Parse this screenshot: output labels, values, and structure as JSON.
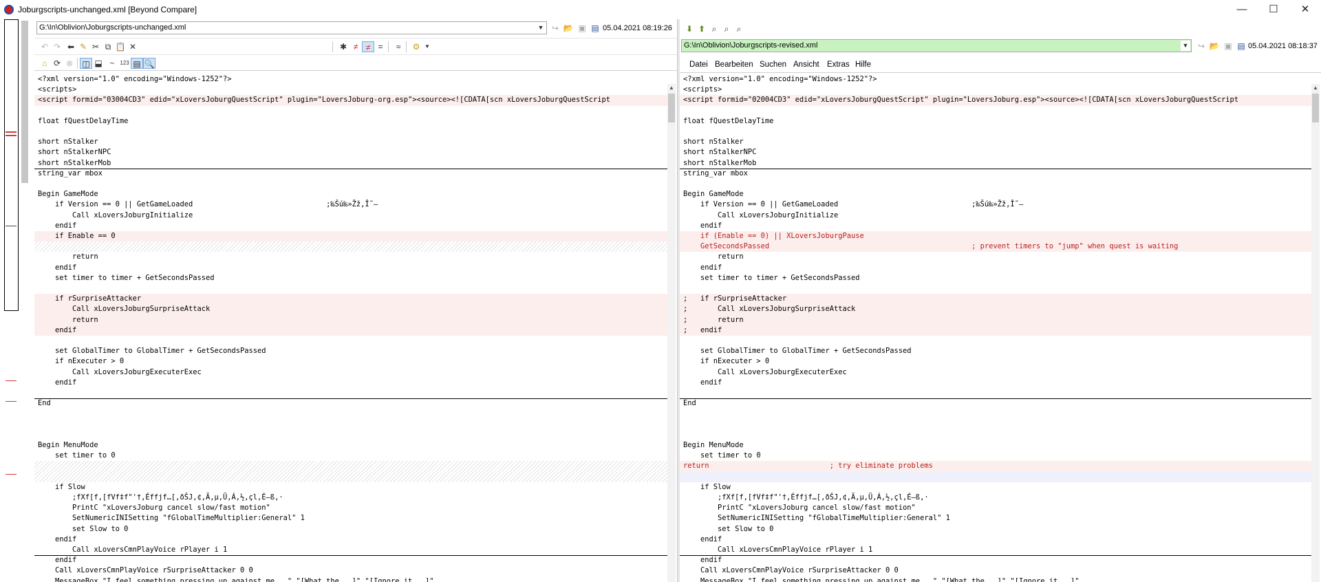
{
  "window": {
    "title": "Joburgscripts-unchanged.xml  [Beyond Compare]",
    "minimize": "—",
    "maximize": "☐",
    "close": "✕"
  },
  "left": {
    "path": "G:\\In\\Oblivion\\Joburgscripts-unchanged.xml",
    "timestamp": "05.04.2021 08:19:26"
  },
  "right": {
    "path": "G:\\In\\Oblivion\\Joburgscripts-revised.xml",
    "timestamp": "05.04.2021 08:18:37",
    "menu": [
      "Datei",
      "Bearbeiten",
      "Suchen",
      "Ansicht",
      "Extras",
      "Hilfe"
    ]
  },
  "toolbar": {
    "icon_123": "123"
  },
  "colors": {
    "diff_bg": "#fdeeee",
    "diff_text": "#b5221e",
    "path_green": "#c8f2c0",
    "blue_row": "#eef0fb"
  },
  "left_lines": [
    {
      "t": "<?xml version=\"1.0\" encoding=\"Windows-1252\"?>",
      "c": ""
    },
    {
      "t": "<scripts>",
      "c": ""
    },
    {
      "t": "<script formid=\"03004CD3\" edid=\"xLoversJoburgQuestScript\" plugin=\"LoversJoburg-org.esp\"><source><![CDATA[scn xLoversJoburgQuestScript",
      "c": "diff"
    },
    {
      "t": "",
      "c": ""
    },
    {
      "t": "float fQuestDelayTime",
      "c": ""
    },
    {
      "t": "",
      "c": ""
    },
    {
      "t": "short nStalker",
      "c": ""
    },
    {
      "t": "short nStalkerNPC",
      "c": ""
    },
    {
      "t": "short nStalkerMob",
      "c": ""
    },
    {
      "t": "string_var mbox",
      "c": ""
    },
    {
      "t": "",
      "c": ""
    },
    {
      "t": "Begin GameMode",
      "c": ""
    },
    {
      "t": "    if Version == 0 || GetGameLoaded                               ;‰Šú‰»Žž,Î˜—",
      "c": ""
    },
    {
      "t": "        Call xLoversJoburgInitialize",
      "c": ""
    },
    {
      "t": "    endif",
      "c": ""
    },
    {
      "t": "    if Enable == 0",
      "c": "diff"
    },
    {
      "t": "",
      "c": "hatch"
    },
    {
      "t": "        return",
      "c": ""
    },
    {
      "t": "    endif",
      "c": ""
    },
    {
      "t": "    set timer to timer + GetSecondsPassed",
      "c": ""
    },
    {
      "t": "",
      "c": ""
    },
    {
      "t": "    if rSurpriseAttacker",
      "c": "diff"
    },
    {
      "t": "        Call xLoversJoburgSurpriseAttack",
      "c": "diff"
    },
    {
      "t": "        return",
      "c": "diff"
    },
    {
      "t": "    endif",
      "c": "diff"
    },
    {
      "t": "",
      "c": ""
    },
    {
      "t": "    set GlobalTimer to GlobalTimer + GetSecondsPassed",
      "c": ""
    },
    {
      "t": "    if nExecuter > 0",
      "c": ""
    },
    {
      "t": "        Call xLoversJoburgExecuterExec",
      "c": ""
    },
    {
      "t": "    endif",
      "c": ""
    },
    {
      "t": "",
      "c": ""
    },
    {
      "t": "End",
      "c": ""
    },
    {
      "t": "",
      "c": ""
    },
    {
      "t": "",
      "c": ""
    },
    {
      "t": "",
      "c": ""
    },
    {
      "t": "Begin MenuMode",
      "c": ""
    },
    {
      "t": "    set timer to 0",
      "c": ""
    },
    {
      "t": "",
      "c": "hatch"
    },
    {
      "t": "",
      "c": "hatch"
    },
    {
      "t": "    if Slow",
      "c": ""
    },
    {
      "t": "        ;fXf[f,[fVf‡f\"'†,Éffjf…[,ðŠJ,¢,Ä,µ,Ü,Á,½,çl,É–ß,·",
      "c": ""
    },
    {
      "t": "        PrintC \"xLoversJoburg cancel slow/fast motion\"",
      "c": ""
    },
    {
      "t": "        SetNumericINISetting \"fGlobalTimeMultiplier:General\" 1",
      "c": ""
    },
    {
      "t": "        set Slow to 0",
      "c": ""
    },
    {
      "t": "    endif",
      "c": ""
    },
    {
      "t": "        Call xLoversCmnPlayVoice rPlayer i 1",
      "c": ""
    },
    {
      "t": "    endif",
      "c": ""
    },
    {
      "t": "    Call xLoversCmnPlayVoice rSurpriseAttacker 0 0",
      "c": ""
    },
    {
      "t": "    MessageBox \"I feel something pressing up against me...\" \"[What the...]\" \"[Ignore it...]\"",
      "c": ""
    }
  ],
  "right_lines": [
    {
      "t": "<?xml version=\"1.0\" encoding=\"Windows-1252\"?>",
      "c": ""
    },
    {
      "t": "<scripts>",
      "c": ""
    },
    {
      "t": "<script formid=\"02004CD3\" edid=\"xLoversJoburgQuestScript\" plugin=\"LoversJoburg.esp\"><source><![CDATA[scn xLoversJoburgQuestScript",
      "c": "diff"
    },
    {
      "t": "",
      "c": ""
    },
    {
      "t": "float fQuestDelayTime",
      "c": ""
    },
    {
      "t": "",
      "c": ""
    },
    {
      "t": "short nStalker",
      "c": ""
    },
    {
      "t": "short nStalkerNPC",
      "c": ""
    },
    {
      "t": "short nStalkerMob",
      "c": ""
    },
    {
      "t": "string_var mbox",
      "c": ""
    },
    {
      "t": "",
      "c": ""
    },
    {
      "t": "Begin GameMode",
      "c": ""
    },
    {
      "t": "    if Version == 0 || GetGameLoaded                               ;‰Šú‰»Žž,Î˜—",
      "c": ""
    },
    {
      "t": "        Call xLoversJoburgInitialize",
      "c": ""
    },
    {
      "t": "    endif",
      "c": ""
    },
    {
      "t": "    if (Enable == 0) || XLoversJoburgPause",
      "c": "diffred"
    },
    {
      "t": "    GetSecondsPassed                                               ; prevent timers to \"jump\" when quest is waiting",
      "c": "diffred"
    },
    {
      "t": "        return",
      "c": ""
    },
    {
      "t": "    endif",
      "c": ""
    },
    {
      "t": "    set timer to timer + GetSecondsPassed",
      "c": ""
    },
    {
      "t": "",
      "c": ""
    },
    {
      "t": ";   if rSurpriseAttacker",
      "c": "diff"
    },
    {
      "t": ";       Call xLoversJoburgSurpriseAttack",
      "c": "diff"
    },
    {
      "t": ";       return",
      "c": "diff"
    },
    {
      "t": ";   endif",
      "c": "diff"
    },
    {
      "t": "",
      "c": ""
    },
    {
      "t": "    set GlobalTimer to GlobalTimer + GetSecondsPassed",
      "c": ""
    },
    {
      "t": "    if nExecuter > 0",
      "c": ""
    },
    {
      "t": "        Call xLoversJoburgExecuterExec",
      "c": ""
    },
    {
      "t": "    endif",
      "c": ""
    },
    {
      "t": "",
      "c": ""
    },
    {
      "t": "End",
      "c": ""
    },
    {
      "t": "",
      "c": ""
    },
    {
      "t": "",
      "c": ""
    },
    {
      "t": "",
      "c": ""
    },
    {
      "t": "Begin MenuMode",
      "c": ""
    },
    {
      "t": "    set timer to 0",
      "c": ""
    },
    {
      "t": "return                            ; try eliminate problems",
      "c": "diffred"
    },
    {
      "t": "",
      "c": "blue"
    },
    {
      "t": "    if Slow",
      "c": ""
    },
    {
      "t": "        ;fXf[f,[fVf‡f\"'†,Éffjf…[,ðŠJ,¢,Ä,µ,Ü,Á,½,çl,É–ß,·",
      "c": ""
    },
    {
      "t": "        PrintC \"xLoversJoburg cancel slow/fast motion\"",
      "c": ""
    },
    {
      "t": "        SetNumericINISetting \"fGlobalTimeMultiplier:General\" 1",
      "c": ""
    },
    {
      "t": "        set Slow to 0",
      "c": ""
    },
    {
      "t": "    endif",
      "c": ""
    },
    {
      "t": "        Call xLoversCmnPlayVoice rPlayer i 1",
      "c": ""
    },
    {
      "t": "    endif",
      "c": ""
    },
    {
      "t": "    Call xLoversCmnPlayVoice rSurpriseAttacker 0 0",
      "c": ""
    },
    {
      "t": "    MessageBox \"I feel something pressing up against me...\" \"[What the...]\" \"[Ignore it...]\"",
      "c": ""
    }
  ]
}
